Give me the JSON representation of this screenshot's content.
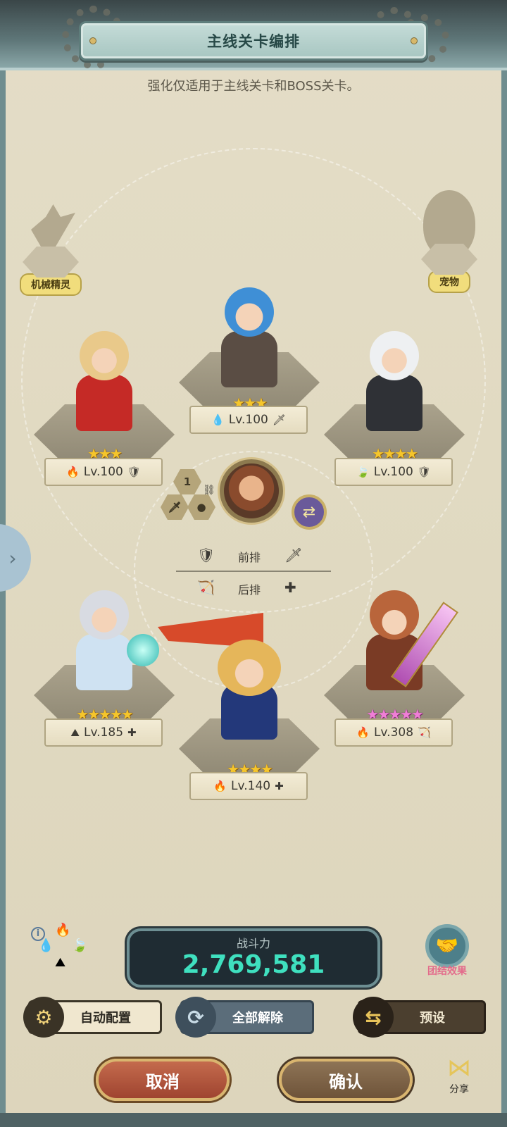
{
  "header": {
    "title": "主线关卡编排",
    "subtitle": "强化仅适用于主线关卡和BOSS关卡。"
  },
  "side_slots": {
    "left_label": "机械精灵",
    "right_label": "宠物"
  },
  "heroes": [
    {
      "id": "top-center",
      "stars": "★★★",
      "star_type": "gold",
      "element_icon": "water-icon",
      "element_glyph": "💧",
      "level": "Lv.100",
      "role_icon": "sword-icon",
      "role_glyph": "🗡"
    },
    {
      "id": "mid-left",
      "stars": "★★★",
      "star_type": "gold",
      "element_icon": "fire-icon",
      "element_glyph": "🔥",
      "level": "Lv.100",
      "role_icon": "shield-icon",
      "role_glyph": "🛡"
    },
    {
      "id": "mid-right",
      "stars": "★★★★",
      "star_type": "gold",
      "element_icon": "wind-icon",
      "element_glyph": "🍃",
      "level": "Lv.100",
      "role_icon": "shield-icon",
      "role_glyph": "🛡"
    },
    {
      "id": "bottom-left",
      "stars": "★★★★★",
      "star_type": "gold",
      "element_icon": "earth-icon",
      "element_glyph": "⛰",
      "level": "Lv.185",
      "role_icon": "heal-icon",
      "role_glyph": "✚"
    },
    {
      "id": "bottom-center",
      "stars": "★★★★",
      "star_type": "gold",
      "element_icon": "fire-icon",
      "element_glyph": "🔥",
      "level": "Lv.140",
      "role_icon": "heal-icon",
      "role_glyph": "✚"
    },
    {
      "id": "bottom-right",
      "stars": "★★★★★",
      "star_type": "pink",
      "element_icon": "fire-icon",
      "element_glyph": "🔥",
      "level": "Lv.308",
      "role_icon": "bow-icon",
      "role_glyph": "🏹"
    }
  ],
  "leader": {
    "slot_number": "1"
  },
  "rows": {
    "front_label": "前排",
    "back_label": "后排"
  },
  "power": {
    "label": "战斗力",
    "value": "2,769,581"
  },
  "unity": {
    "label": "团结效果"
  },
  "actions": {
    "auto_label": "自动配置",
    "clear_all_label": "全部解除",
    "preset_label": "预设"
  },
  "footer": {
    "cancel_label": "取消",
    "confirm_label": "确认",
    "share_label": "分享"
  },
  "colors": {
    "power_value": "#3fe0bf",
    "star_gold": "#f5c62c",
    "star_pink": "#ef7fd6",
    "unity_label": "#e36b8b"
  }
}
